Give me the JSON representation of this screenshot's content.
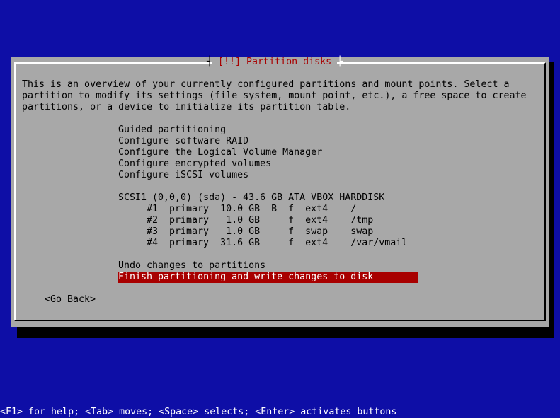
{
  "dialog": {
    "title": "[!!] Partition disks",
    "description": [
      "This is an overview of your currently configured partitions and mount points. Select a",
      "partition to modify its settings (file system, mount point, etc.), a free space to create",
      "partitions, or a device to initialize its partition table."
    ],
    "menu": [
      "Guided partitioning",
      "Configure software RAID",
      "Configure the Logical Volume Manager",
      "Configure encrypted volumes",
      "Configure iSCSI volumes"
    ],
    "disk": "SCSI1 (0,0,0) (sda) - 43.6 GB ATA VBOX HARDDISK",
    "partitions": [
      "#1  primary  10.0 GB  B  f  ext4    /",
      "#2  primary   1.0 GB     f  ext4    /tmp",
      "#3  primary   1.0 GB     f  swap    swap",
      "#4  primary  31.6 GB     f  ext4    /var/vmail"
    ],
    "undo": "Undo changes to partitions",
    "finish": "Finish partitioning and write changes to disk",
    "go_back": "<Go Back>"
  },
  "footer": "<F1> for help; <Tab> moves; <Space> selects; <Enter> activates buttons"
}
